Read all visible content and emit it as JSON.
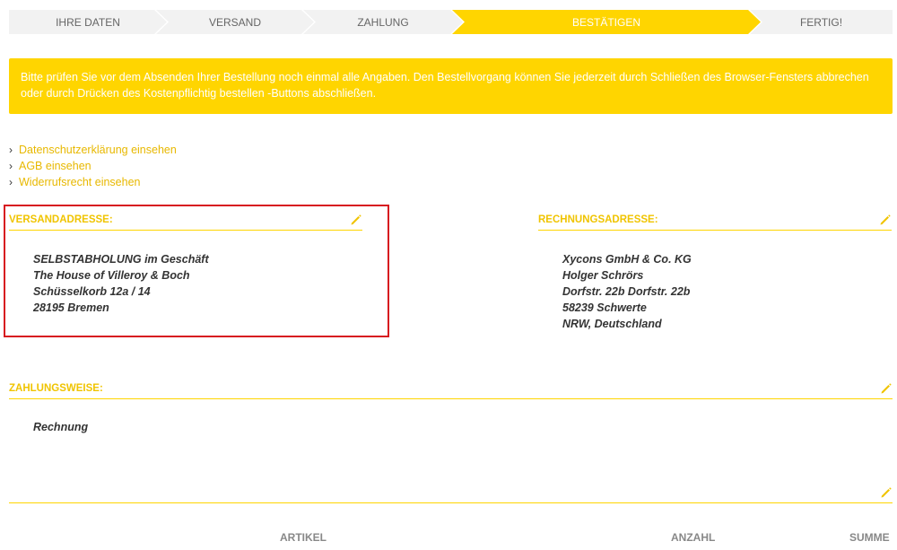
{
  "steps": [
    {
      "label": "IHRE DATEN"
    },
    {
      "label": "VERSAND"
    },
    {
      "label": "ZAHLUNG"
    },
    {
      "label": "BESTÄTIGEN"
    },
    {
      "label": "FERTIG!"
    }
  ],
  "banner_text_line1": "Bitte prüfen Sie vor dem Absenden Ihrer Bestellung noch einmal alle Angaben. Den Bestellvorgang können Sie jederzeit durch Schließen des Browser-Fensters abbrechen",
  "banner_text_line2": "oder durch Drücken des Kostenpflichtig bestellen -Buttons abschließen.",
  "links": [
    {
      "label": "Datenschutzerklärung einsehen"
    },
    {
      "label": "AGB einsehen"
    },
    {
      "label": "Widerrufsrecht einsehen"
    }
  ],
  "shipping": {
    "title": "VERSANDADRESSE:",
    "lines": [
      "SELBSTABHOLUNG im Geschäft",
      "The House of Villeroy & Boch",
      "Schüsselkorb 12a / 14",
      "28195 Bremen"
    ]
  },
  "billing": {
    "title": "RECHNUNGSADRESSE:",
    "lines": [
      "Xycons GmbH & Co. KG",
      "Holger Schrörs",
      "Dorfstr. 22b Dorfstr. 22b",
      "58239 Schwerte",
      "NRW, Deutschland"
    ]
  },
  "payment": {
    "title": "ZAHLUNGSWEISE:",
    "method": "Rechnung"
  },
  "table_headers": {
    "article": "ARTIKEL",
    "quantity": "ANZAHL",
    "sum": "SUMME"
  },
  "colors": {
    "accent": "#ffd500",
    "highlight": "#d71920"
  }
}
